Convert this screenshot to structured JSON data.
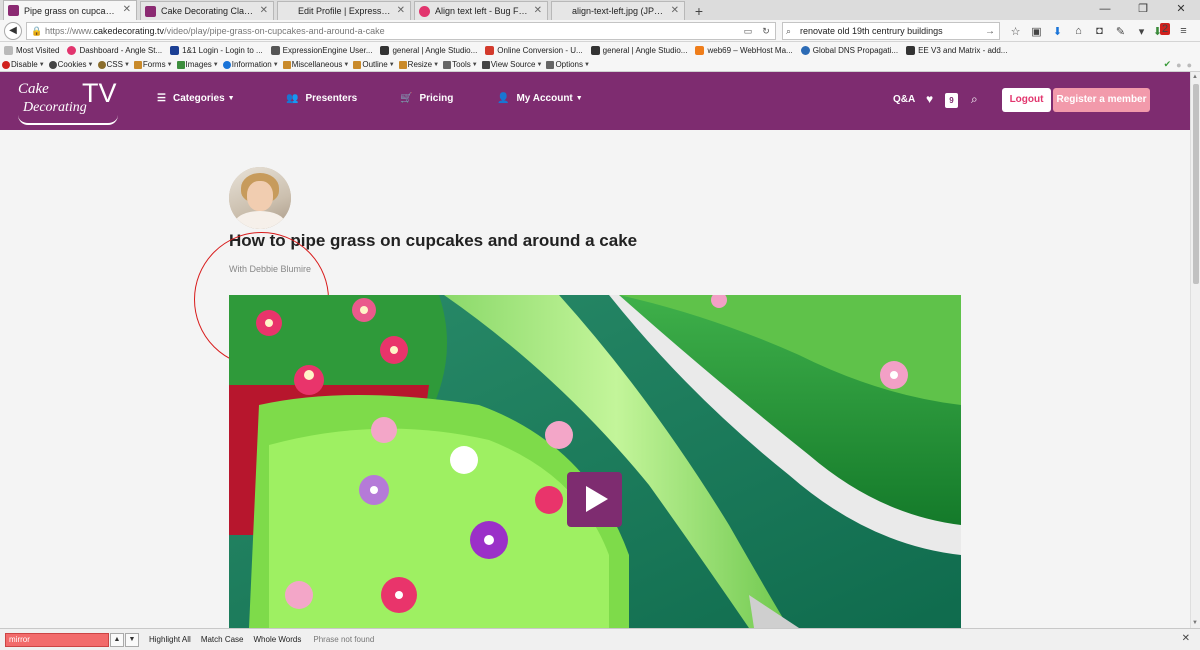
{
  "browser": {
    "tabs": [
      {
        "title": "Pipe grass on cupcakes an...",
        "favicon": "cake-tv-favicon",
        "active": true
      },
      {
        "title": "Cake Decorating Classes A...",
        "favicon": "cake-tv-favicon",
        "active": false
      },
      {
        "title": "Edit Profile | ExpressionEngine",
        "favicon": "none",
        "active": false
      },
      {
        "title": "Align text left - Bug Fixes /...",
        "favicon": "bug-favicon",
        "active": false
      },
      {
        "title": "align-text-left.jpg (JPEG Image...",
        "favicon": "none",
        "active": false
      }
    ],
    "new_tab": "+",
    "window_controls": [
      "—",
      "❐",
      "✕"
    ],
    "url_prefix": "https://www.",
    "url_domain": "cakedecorating.tv",
    "url_path": "/video/play/pipe-grass-on-cupcakes-and-around-a-cake",
    "search_value": "renovate old 19th centrury buildings",
    "notification_count": "2"
  },
  "bookmarks": [
    {
      "label": "Most Visited",
      "color": "#b9b9b9"
    },
    {
      "label": "Dashboard - Angle St...",
      "color": "#e2356e"
    },
    {
      "label": "1&1 Login - Login to ...",
      "color": "#1c3f94"
    },
    {
      "label": "ExpressionEngine User...",
      "color": "#555555"
    },
    {
      "label": "general | Angle Studio...",
      "color": "#333333"
    },
    {
      "label": "Online Conversion - U...",
      "color": "#d33a2c"
    },
    {
      "label": "general | Angle Studio...",
      "color": "#333333"
    },
    {
      "label": "web69 – WebHost Ma...",
      "color": "#ef7d1a"
    },
    {
      "label": "Global DNS Propagati...",
      "color": "#2c6bb5"
    },
    {
      "label": "EE V3 and Matrix - add...",
      "color": "#333333"
    }
  ],
  "devtools": [
    {
      "label": "Disable",
      "color": "#d0211d"
    },
    {
      "label": "Cookies",
      "color": "#444444"
    },
    {
      "label": "CSS",
      "color": "#8a6d2c"
    },
    {
      "label": "Forms",
      "color": "#c98a2a"
    },
    {
      "label": "Images",
      "color": "#3e8e3e"
    },
    {
      "label": "Information",
      "color": "#1a74d8"
    },
    {
      "label": "Miscellaneous",
      "color": "#c98a2a"
    },
    {
      "label": "Outline",
      "color": "#c98a2a"
    },
    {
      "label": "Resize",
      "color": "#c98a2a"
    },
    {
      "label": "Tools",
      "color": "#666666"
    },
    {
      "label": "View Source",
      "color": "#444444"
    },
    {
      "label": "Options",
      "color": "#666666"
    }
  ],
  "site": {
    "logo_line1": "Cake",
    "logo_tv": "TV",
    "logo_line2": "Decorating",
    "nav": [
      {
        "label": "Categories",
        "icon": "list-icon",
        "dropdown": true
      },
      {
        "label": "Presenters",
        "icon": "users-icon",
        "dropdown": false
      },
      {
        "label": "Pricing",
        "icon": "cart-icon",
        "dropdown": false
      },
      {
        "label": "My Account",
        "icon": "user-icon",
        "dropdown": true
      }
    ],
    "qa_label": "Q&A",
    "favorites_count": "9",
    "logout_label": "Logout",
    "register_label": "Register a member",
    "brand_color": "#7e2c70",
    "accent_color": "#e2356e"
  },
  "video": {
    "title": "How to pipe grass on cupcakes and around a cake",
    "presenter": "With Debbie Blumire"
  },
  "findbar": {
    "query": "mirror",
    "highlight_all": "Highlight All",
    "match_case": "Match Case",
    "whole_words": "Whole Words",
    "status": "Phrase not found"
  }
}
